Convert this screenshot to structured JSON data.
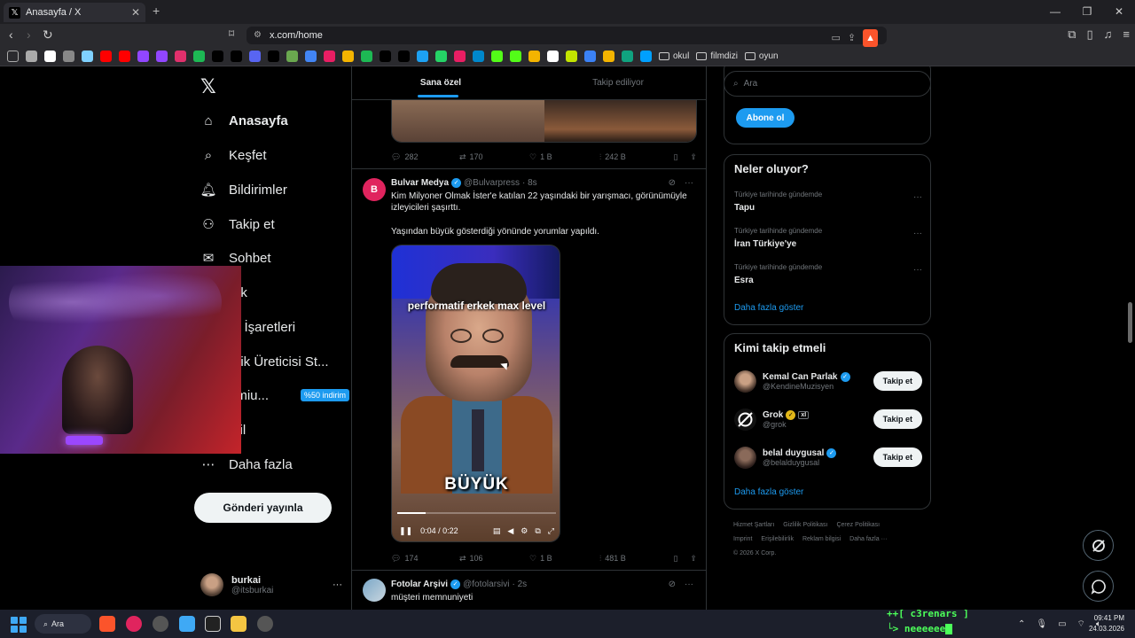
{
  "browser": {
    "tab_title": "Anasayfa / X",
    "tab_close": "✕",
    "new_tab": "+",
    "url": "x.com/home",
    "bookmark_folders": [
      "okul",
      "filmdizi",
      "oyun"
    ],
    "bookmark_icon_colors": [
      "#aaaaaa",
      "#ffffff",
      "#888888",
      "#7fd1ff",
      "#ff0000",
      "#ff0000",
      "#9146ff",
      "#9146ff",
      "#e1306c",
      "#1db954",
      "#000000",
      "#000000",
      "#5865f2",
      "#000000",
      "#6aa84f",
      "#4285f4",
      "#e91e63",
      "#f4b400",
      "#1db954",
      "#000000",
      "#000000",
      "#1da1f2",
      "#25d366",
      "#e91e63",
      "#0088cc",
      "#53fc18",
      "#53fc18",
      "#f4b400",
      "#ffffff",
      "#c3e400",
      "#3b82f6",
      "#f4b400",
      "#10a37f",
      "#00a0ff"
    ]
  },
  "sidebar": {
    "items": [
      {
        "label": "Anasayfa",
        "icon": "home-icon"
      },
      {
        "label": "Keşfet",
        "icon": "search-icon"
      },
      {
        "label": "Bildirimler",
        "icon": "bell-icon"
      },
      {
        "label": "Takip et",
        "icon": "add-user-icon"
      },
      {
        "label": "Sohbet",
        "icon": "mail-icon"
      },
      {
        "label": "rok",
        "icon": "grok-icon"
      },
      {
        "label": "er İşaretleri",
        "icon": "bookmark-icon"
      },
      {
        "label": "erik Üreticisi St...",
        "icon": "creator-icon"
      },
      {
        "label": "emiu...",
        "icon": "premium-icon"
      },
      {
        "label": "ofil",
        "icon": "profile-icon"
      },
      {
        "label": "Daha fazla",
        "icon": "more-circle-icon"
      }
    ],
    "premium_badge": "%50 indirim",
    "post_button": "Gönderi yayınla",
    "profile": {
      "name": "burkai",
      "handle": "@itsburkai",
      "more": "···"
    }
  },
  "timeline": {
    "tabs": [
      "Sana özel",
      "Takip ediliyor"
    ],
    "prev_tweet_actions": {
      "replies": "282",
      "retweets": "170",
      "likes": "1 B",
      "views": "242 B"
    },
    "tweet": {
      "avatar_letter": "B",
      "name": "Bulvar Medya",
      "handle": "@Bulvarpress",
      "time": "· 8s",
      "text1": "Kim Milyoner Olmak İster'e katılan 22 yaşındaki bir yarışmacı, görünümüyle izleyicileri şaşırttı.",
      "text2": "Yaşından büyük gösterdiği yönünde yorumlar yapıldı.",
      "video": {
        "caption_top": "performatif erkek max level",
        "caption_bottom": "BÜYÜK",
        "time": "0:04 / 0:22",
        "progress": 0.18
      },
      "actions": {
        "replies": "174",
        "retweets": "106",
        "likes": "1 B",
        "views": "481 B"
      }
    },
    "next_tweet": {
      "name": "Fotolar Arşivi",
      "handle": "@fotolarsivi",
      "time": "· 2s",
      "text": "müşteri memnuniyeti"
    }
  },
  "rightcol": {
    "search_placeholder": "Ara",
    "sub_text": "...",
    "subscribe_button": "Abone ol",
    "trends_title": "Neler oluyor?",
    "trends": [
      {
        "context": "Türkiye tarihinde gündemde",
        "name": "Tapu"
      },
      {
        "context": "Türkiye tarihinde gündemde",
        "name": "İran Türkiye'ye"
      },
      {
        "context": "Türkiye tarihinde gündemde",
        "name": "Esra"
      }
    ],
    "show_more": "Daha fazla göster",
    "who_title": "Kimi takip etmeli",
    "who": [
      {
        "name": "Kemal Can Parlak",
        "handle": "@KendineMuzisyen",
        "button": "Takip et",
        "badge": "blue"
      },
      {
        "name": "Grok",
        "handle": "@grok",
        "button": "Takip et",
        "badge": "gold"
      },
      {
        "name": "belal duygusal",
        "handle": "@belalduygusal",
        "button": "Takip et",
        "badge": "blue"
      }
    ],
    "footer": [
      "Hizmet Şartları",
      "Gizlilik Politikası",
      "Çerez Politikası",
      "Imprint",
      "Erişilebilirlik",
      "Reklam bilgisi",
      "Daha fazla ···",
      "© 2026 X Corp."
    ]
  },
  "taskbar": {
    "search": "Ara",
    "terminal_line1": "++[ c3renars ]",
    "terminal_line2": "└> neeeeee",
    "time": "09:41 PM",
    "date": "24.03.2026"
  }
}
